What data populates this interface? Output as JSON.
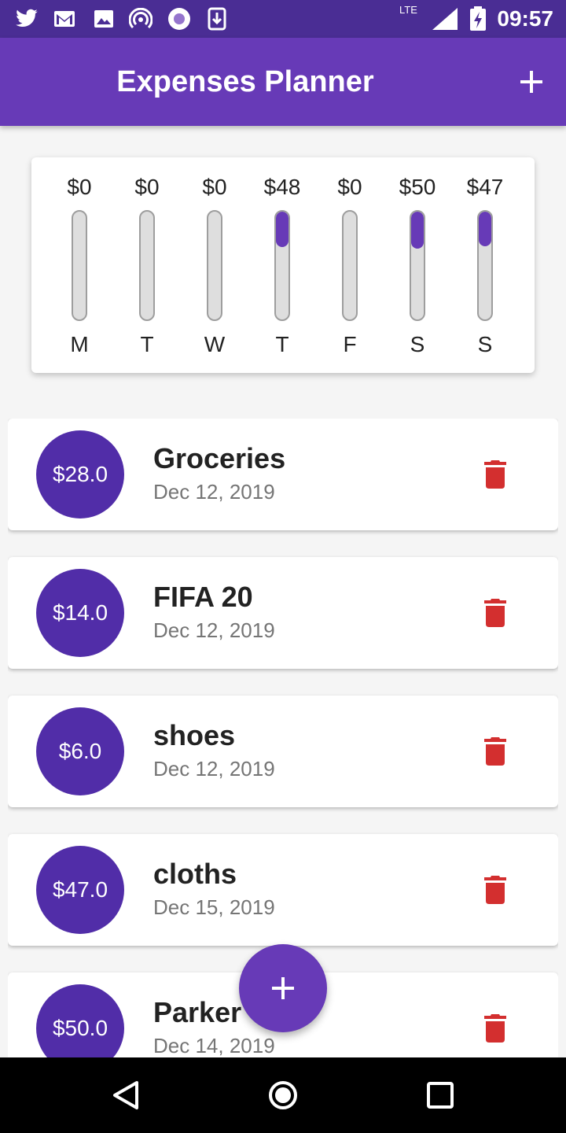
{
  "status_bar": {
    "time": "09:57",
    "network": "LTE",
    "notification_icons": [
      "twitter-icon",
      "gmail-icon",
      "image-icon",
      "hotspot-icon",
      "record-icon",
      "download-icon"
    ],
    "system_icons": [
      "lte-icon",
      "signal-icon",
      "battery-charging-icon"
    ]
  },
  "app_bar": {
    "title": "Expenses Planner",
    "add_icon": "add-icon"
  },
  "weekly_chart": {
    "days": [
      {
        "label": "M",
        "amount": "$0",
        "fraction": 0
      },
      {
        "label": "T",
        "amount": "$0",
        "fraction": 0
      },
      {
        "label": "W",
        "amount": "$0",
        "fraction": 0
      },
      {
        "label": "T",
        "amount": "$48",
        "fraction": 0.33
      },
      {
        "label": "F",
        "amount": "$0",
        "fraction": 0
      },
      {
        "label": "S",
        "amount": "$50",
        "fraction": 0.34
      },
      {
        "label": "S",
        "amount": "$47",
        "fraction": 0.32
      }
    ]
  },
  "expenses": [
    {
      "amount": "$28.0",
      "title": "Groceries",
      "date": "Dec 12, 2019"
    },
    {
      "amount": "$14.0",
      "title": "FIFA 20",
      "date": "Dec 12, 2019"
    },
    {
      "amount": "$6.0",
      "title": "shoes",
      "date": "Dec 12, 2019"
    },
    {
      "amount": "$47.0",
      "title": "cloths",
      "date": "Dec 15, 2019"
    },
    {
      "amount": "$50.0",
      "title": "Parker",
      "date": "Dec 14, 2019"
    }
  ],
  "fab_icon": "add-icon",
  "nav_bar": {
    "icons": [
      "back-icon",
      "home-icon",
      "recents-icon"
    ]
  },
  "colors": {
    "primary": "#673ab7",
    "primary_dark": "#4a2d94",
    "avatar": "#512da8",
    "delete": "#d32f2f"
  }
}
